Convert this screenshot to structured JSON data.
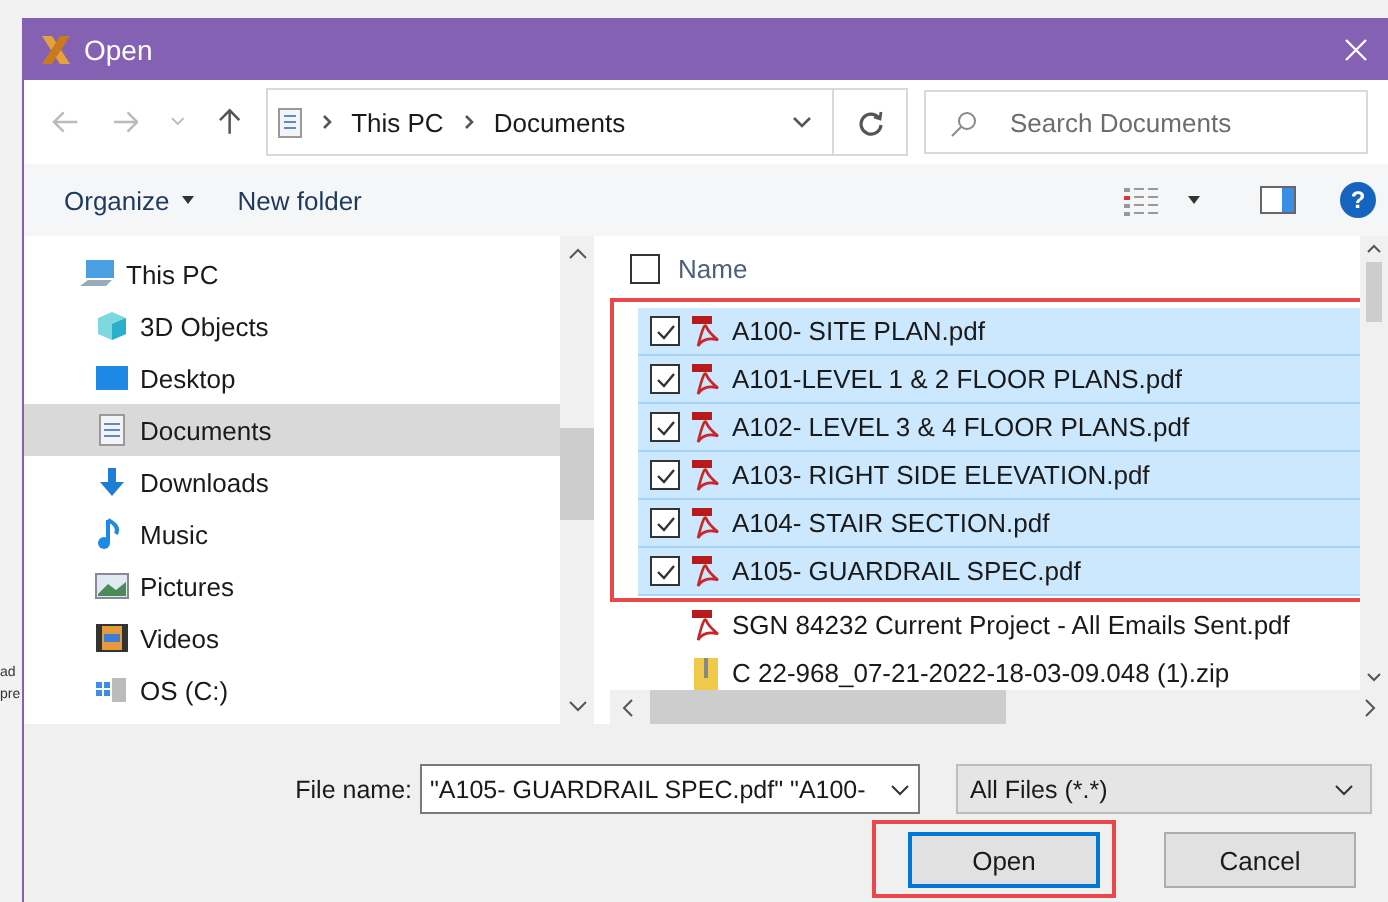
{
  "backdrop": {
    "texts": [
      "ad",
      "pre"
    ]
  },
  "window": {
    "title": "Open"
  },
  "address": {
    "path": [
      "This PC",
      "Documents"
    ]
  },
  "search": {
    "placeholder": "Search Documents"
  },
  "toolbar": {
    "items": [
      {
        "label": "Organize",
        "menu": true
      },
      {
        "label": "New folder",
        "menu": false
      }
    ],
    "help": "?"
  },
  "sidebar": {
    "items": [
      {
        "label": "This PC",
        "kind": "pc",
        "selected": false,
        "children": [
          {
            "label": "3D Objects",
            "kind": "cube",
            "selected": false
          },
          {
            "label": "Desktop",
            "kind": "desktop",
            "selected": false
          },
          {
            "label": "Documents",
            "kind": "document",
            "selected": true
          },
          {
            "label": "Downloads",
            "kind": "download",
            "selected": false
          },
          {
            "label": "Music",
            "kind": "music",
            "selected": false
          },
          {
            "label": "Pictures",
            "kind": "picture",
            "selected": false
          },
          {
            "label": "Videos",
            "kind": "video",
            "selected": false
          },
          {
            "label": "OS (C:)",
            "kind": "drive",
            "selected": false
          }
        ]
      }
    ]
  },
  "file_list": {
    "header": "Name",
    "header_checked": false,
    "files": [
      {
        "name": "A100- SITE PLAN.pdf",
        "kind": "pdf",
        "checked": true,
        "selected": true
      },
      {
        "name": "A101-LEVEL 1 & 2 FLOOR PLANS.pdf",
        "kind": "pdf",
        "checked": true,
        "selected": true
      },
      {
        "name": "A102- LEVEL 3 & 4 FLOOR PLANS.pdf",
        "kind": "pdf",
        "checked": true,
        "selected": true
      },
      {
        "name": "A103- RIGHT SIDE ELEVATION.pdf",
        "kind": "pdf",
        "checked": true,
        "selected": true
      },
      {
        "name": "A104- STAIR SECTION.pdf",
        "kind": "pdf",
        "checked": true,
        "selected": true
      },
      {
        "name": "A105- GUARDRAIL SPEC.pdf",
        "kind": "pdf",
        "checked": true,
        "selected": true
      },
      {
        "name": "SGN 84232 Current Project - All Emails Sent.pdf",
        "kind": "pdf",
        "checked": false,
        "selected": false
      },
      {
        "name": "C 22-968_07-21-2022-18-03-09.048 (1).zip",
        "kind": "zip",
        "checked": false,
        "selected": false
      }
    ]
  },
  "footer": {
    "file_name_label": "File name:",
    "file_name": "\"A105- GUARDRAIL SPEC.pdf\" \"A100-",
    "file_type": "All Files (*.*)",
    "buttons": [
      {
        "label": "Open",
        "default": true,
        "highlighted": true
      },
      {
        "label": "Cancel",
        "default": false,
        "highlighted": false
      }
    ]
  }
}
